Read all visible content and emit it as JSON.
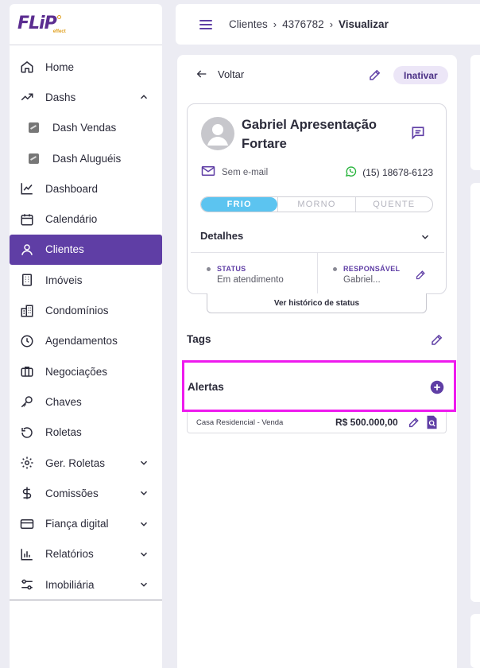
{
  "brand": {
    "logo_text": "FLiP",
    "logo_sub": "effect"
  },
  "sidebar": {
    "items": [
      {
        "label": "Home"
      },
      {
        "label": "Dashs"
      },
      {
        "label": "Dash Vendas"
      },
      {
        "label": "Dash Aluguéis"
      },
      {
        "label": "Dashboard"
      },
      {
        "label": "Calendário"
      },
      {
        "label": "Clientes"
      },
      {
        "label": "Imóveis"
      },
      {
        "label": "Condomínios"
      },
      {
        "label": "Agendamentos"
      },
      {
        "label": "Negociações"
      },
      {
        "label": "Chaves"
      },
      {
        "label": "Roletas"
      },
      {
        "label": "Ger. Roletas"
      },
      {
        "label": "Comissões"
      },
      {
        "label": "Fiança digital"
      },
      {
        "label": "Relatórios"
      },
      {
        "label": "Imobiliária"
      }
    ]
  },
  "header": {
    "breadcrumb": [
      "Clientes",
      "4376782",
      "Visualizar"
    ]
  },
  "panel": {
    "back_label": "Voltar",
    "inativar_label": "Inativar",
    "client": {
      "name": "Gabriel Apresentação Fortare",
      "email": "Sem e-mail",
      "phone": "(15) 18678-6123",
      "temperature": [
        "FRIO",
        "MORNO",
        "QUENTE"
      ],
      "selected_temperature": "FRIO"
    },
    "details": {
      "title": "Detalhes",
      "status_label": "STATUS",
      "status_value": "Em atendimento",
      "responsavel_label": "RESPONSÁVEL",
      "responsavel_value": "Gabriel..."
    },
    "history_button": "Ver histórico de status",
    "tags_title": "Tags",
    "alerts_title": "Alertas",
    "property": {
      "label": "Casa Residencial - Venda",
      "price": "R$ 500.000,00"
    }
  },
  "colors": {
    "accent": "#5f3ea5",
    "highlight_border": "#ee1aee",
    "temperature_selected": "#5cc4f0",
    "whatsapp": "#25b33a"
  }
}
